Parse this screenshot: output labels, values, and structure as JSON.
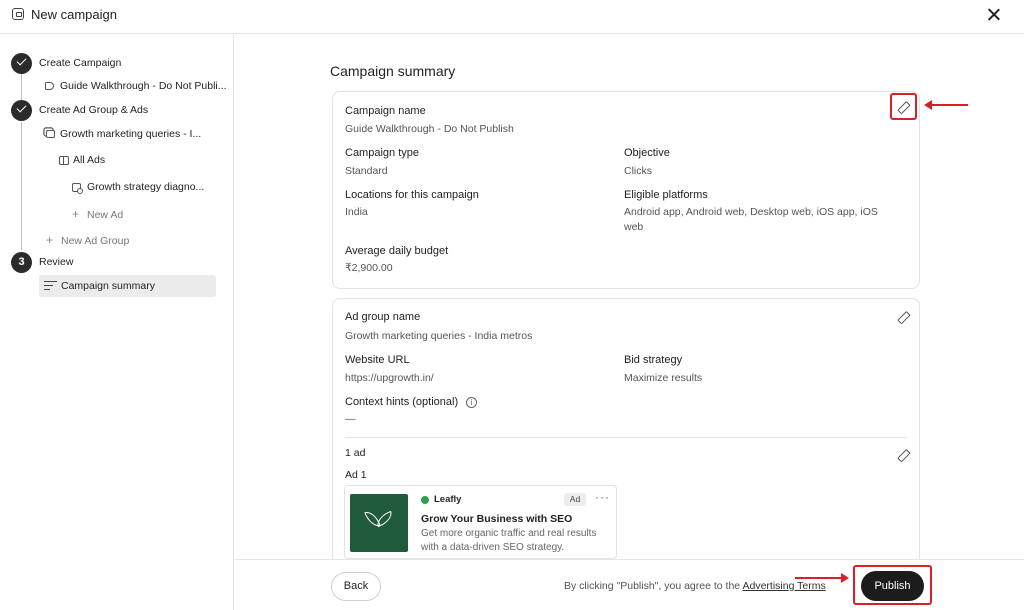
{
  "header": {
    "title": "New campaign"
  },
  "sidebar": {
    "steps": [
      {
        "label": "Create Campaign",
        "status": "done"
      },
      {
        "label": "Create Ad Group & Ads",
        "status": "done"
      },
      {
        "label": "Review",
        "number": "3",
        "status": "current"
      }
    ],
    "campaign_item": "Guide Walkthrough - Do Not Publi...",
    "ad_group_item": "Growth marketing queries - I...",
    "all_ads": "All Ads",
    "ad_item": "Growth strategy diagno...",
    "new_ad": "New Ad",
    "new_ad_group": "New Ad Group",
    "review_item": "Campaign summary"
  },
  "main": {
    "section_title": "Campaign summary",
    "campaign": {
      "name_label": "Campaign name",
      "name_value": "Guide Walkthrough - Do Not Publish",
      "type_label": "Campaign type",
      "type_value": "Standard",
      "objective_label": "Objective",
      "objective_value": "Clicks",
      "locations_label": "Locations for this campaign",
      "locations_value": "India",
      "platforms_label": "Eligible platforms",
      "platforms_value": "Android app, Android web, Desktop web, iOS app, iOS web",
      "budget_label": "Average daily budget",
      "budget_value": "₹2,900.00"
    },
    "ad_group": {
      "name_label": "Ad group name",
      "name_value": "Growth marketing queries - India metros",
      "url_label": "Website URL",
      "url_value": "https://upgrowth.in/",
      "bid_label": "Bid strategy",
      "bid_value": "Maximize results",
      "hints_label": "Context hints (optional)",
      "hints_value": "—",
      "ads_count": "1 ad",
      "ad_title": "Ad 1"
    },
    "ad_preview": {
      "brand": "Leafly",
      "badge": "Ad",
      "more": "···",
      "headline": "Grow Your Business with SEO",
      "description": "Get more organic traffic and real results with a data-driven SEO strategy."
    }
  },
  "footer": {
    "back_label": "Back",
    "terms_prefix": "By clicking \"Publish\", you agree to the ",
    "terms_link": "Advertising Terms",
    "publish_label": "Publish"
  },
  "colors": {
    "accent_dark": "#1c1c1c",
    "annotation_red": "#d8202a",
    "ad_image_green": "#1f5a3a",
    "brand_dot_green": "#2f9e4f"
  }
}
